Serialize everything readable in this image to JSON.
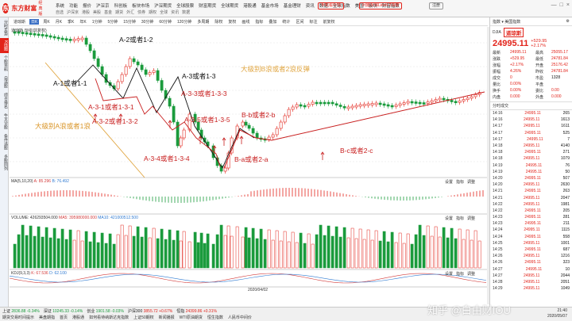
{
  "app": {
    "logo_text": "东方财富",
    "logo_sub": "经典版",
    "logo_mark": "东"
  },
  "menu": [
    "系统",
    "功能",
    "报价",
    "沪深京",
    "科创板",
    "板块市场",
    "沪深期货",
    "全球股票",
    "财富期货",
    "全球期货",
    "港股通",
    "基金市场",
    "基金理财",
    "资讯",
    "数据",
    "全球指数",
    "美国",
    "板块",
    "财富指数"
  ],
  "submenu": [
    "自选",
    "沪深京",
    "港股",
    "美股",
    "基金",
    "期货",
    "外汇",
    "债券",
    "期权",
    "全球",
    "资讯",
    "数据"
  ],
  "top_buttons": {
    "phone": "手机看行情",
    "newbie": "问题反馈Level-2领取",
    "register": "注册"
  },
  "window_controls": [
    "—",
    "□",
    "×"
  ],
  "leftbar": [
    "分时走势",
    "K线图",
    "个股资料",
    "自选股",
    "综合排名",
    "牛叉诊股",
    "条件选股",
    "多股同列"
  ],
  "chart_tabs": [
    "道琼斯",
    "日K",
    "周K",
    "月K",
    "季K",
    "年K",
    "1分钟",
    "5分钟",
    "15分钟",
    "30分钟",
    "60分钟",
    "120分钟",
    "多周期",
    "除权",
    "复权",
    "画线",
    "指标",
    "叠加",
    "统计",
    "区间",
    "标注",
    "前复权"
  ],
  "chart_title": "道琼斯   日线(前复权)",
  "annotations": {
    "a1": "A-1或者1-1",
    "a2": "A-2或者1-2",
    "a31": "A-3-1或者1-3-1",
    "a32": "A-3-2或者1-3-2",
    "a3": "A-3或者1-3",
    "a33": "A-3-3或者1-3-3",
    "a34": "A-3-4或者1-3-4",
    "a35": "A-3-5或者1-3-5",
    "ba": "B-a或者2-a",
    "bb": "B-b或者2-b",
    "bc": "B-c或者2-c",
    "big_a": "大级别A浪或者1浪",
    "big_b": "大级别B浪或者2浪反弹"
  },
  "sub1": {
    "name": "MA(5,10,20)",
    "a": "A: 85.296",
    "b": "B: 76.492",
    "right": [
      "设置",
      "指标",
      "调整"
    ]
  },
  "sub2": {
    "name": "VOLUME: 426293504.000",
    "a": "MA5: 395980000.000",
    "b": "MA10: 421000512.500",
    "right": [
      "设置",
      "指标",
      "调整"
    ]
  },
  "sub3": {
    "name": "KDJ(9,3,3)",
    "a": "K: 67.536",
    "b": "D: 62.100",
    "right": [
      "设置",
      "指标",
      "调整"
    ]
  },
  "date_label": "2020/04/02",
  "right_panel": {
    "header": "指数 ▾ 美国指数",
    "code": "DJIA",
    "name_cn": "道琼斯",
    "price": "24995.11",
    "change": "+529.95",
    "change_pct": "+2.17%",
    "rows": [
      [
        "最新",
        "24995.11",
        "最高",
        "25055.17"
      ],
      [
        "涨跌",
        "+529.95",
        "最低",
        "24781.84"
      ],
      [
        "涨幅",
        "+2.17%",
        "开盘",
        "25176.42"
      ],
      [
        "振幅",
        "4.26%",
        "昨收",
        "24781.84"
      ],
      [
        "成交",
        "0",
        "市盈",
        "1328"
      ],
      [
        "量比",
        "0.00%",
        "平盘",
        ""
      ],
      [
        "换手",
        "0.00%",
        "委比",
        "0.00"
      ],
      [
        "内盘",
        "0.000",
        "外盘",
        "0.000"
      ]
    ],
    "ticks_title": "分时成交",
    "ticks": [
      [
        "14:16",
        "24995.11",
        "265"
      ],
      [
        "14:16",
        "24995.11",
        "1613"
      ],
      [
        "14:17",
        "24995.11",
        "1611"
      ],
      [
        "14:17",
        "24995.11",
        "525"
      ],
      [
        "14:17",
        "24995.11",
        "7"
      ],
      [
        "14:18",
        "24995.11",
        "4140"
      ],
      [
        "14:18",
        "24995.11",
        "271"
      ],
      [
        "14:18",
        "24995.11",
        "1079"
      ],
      [
        "14:19",
        "24995.11",
        "76"
      ],
      [
        "14:19",
        "24995.11",
        "50"
      ],
      [
        "14:20",
        "24995.11",
        "507"
      ],
      [
        "14:20",
        "24995.11",
        "2630"
      ],
      [
        "14:21",
        "24995.11",
        "263"
      ],
      [
        "14:21",
        "24995.11",
        "2047"
      ],
      [
        "14:22",
        "24995.11",
        "1981"
      ],
      [
        "14:22",
        "24995.11",
        "205"
      ],
      [
        "14:23",
        "24995.11",
        "281"
      ],
      [
        "14:23",
        "24995.11",
        "211"
      ],
      [
        "14:24",
        "24995.11",
        "1115"
      ],
      [
        "14:24",
        "24995.11",
        "558"
      ],
      [
        "14:25",
        "24995.11",
        "1001"
      ],
      [
        "14:25",
        "24995.11",
        "687"
      ],
      [
        "14:26",
        "24995.11",
        "1216"
      ],
      [
        "14:26",
        "24995.11",
        "323"
      ],
      [
        "14:27",
        "24995.11",
        "10"
      ],
      [
        "14:27",
        "24995.11",
        "2044"
      ],
      [
        "14:28",
        "24995.11",
        "2051"
      ],
      [
        "14:29",
        "24995.11",
        "1049"
      ]
    ]
  },
  "status": {
    "items": [
      {
        "label": "上证",
        "val": "2836.88",
        "chg": "-0.34%",
        "c": "#1a9b3c"
      },
      {
        "label": "深证",
        "val": "10245.33",
        "chg": "-0.14%",
        "c": "#1a9b3c"
      },
      {
        "label": "创业",
        "val": "1901.58",
        "chg": "-0.03%",
        "c": "#1a9b3c"
      },
      {
        "label": "沪深300",
        "val": "3855.72",
        "chg": "+0.67%",
        "c": "#e2231a"
      },
      {
        "label": "恒指",
        "val": "24399.86",
        "chg": "+0.31%",
        "c": "#e2231a"
      }
    ],
    "ticker": [
      "期货交易时间提示",
      "美盘期指",
      "首页",
      "港股通",
      "如何看待纳斯达克指数",
      "上证50期权",
      "新闻播报",
      "WTI原油期货",
      "恒生指数",
      "人民币中间价"
    ],
    "watermark": "知乎 @白由财IOU",
    "time": "21:40",
    "date": "2020/05/07"
  }
}
